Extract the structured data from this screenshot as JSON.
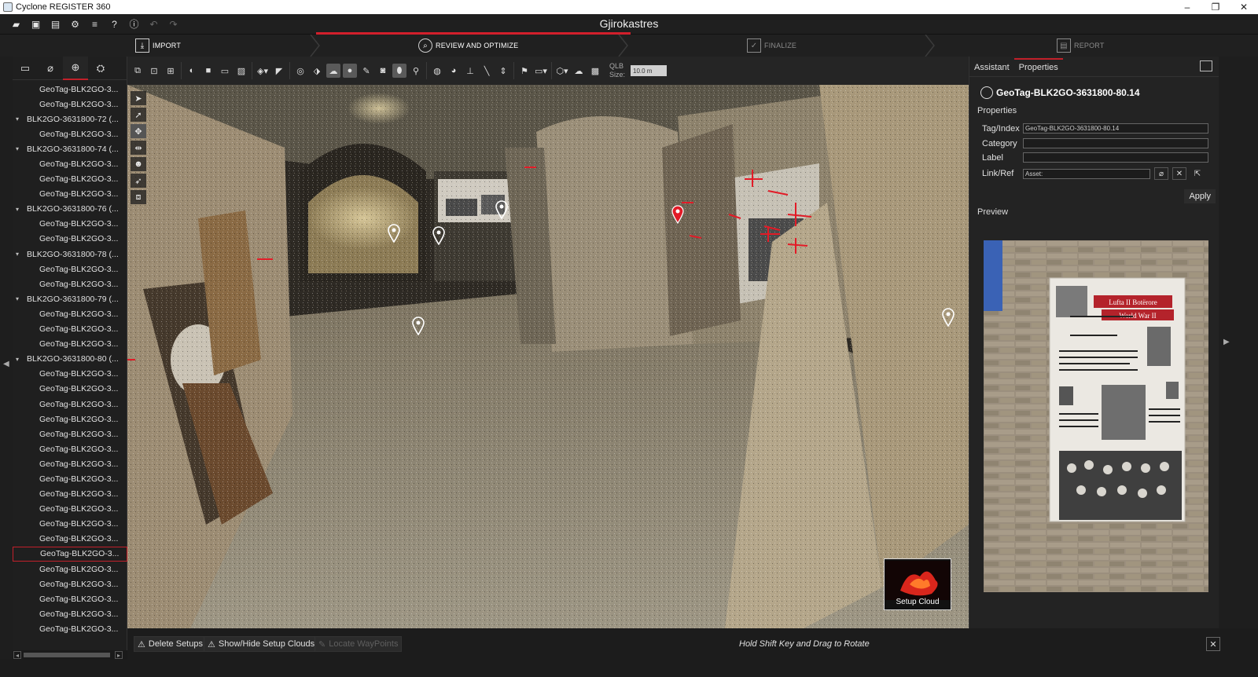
{
  "window": {
    "title": "Cyclone REGISTER 360",
    "controls": [
      "–",
      "❐",
      "✕"
    ]
  },
  "project": {
    "title": "Gjirokastres"
  },
  "workflow": {
    "steps": [
      {
        "label": "IMPORT",
        "icon": "import-icon",
        "state": "done"
      },
      {
        "label": "REVIEW AND OPTIMIZE",
        "icon": "review-icon",
        "state": "active"
      },
      {
        "label": "FINALIZE",
        "icon": "finalize-icon",
        "state": "inactive"
      },
      {
        "label": "REPORT",
        "icon": "report-icon",
        "state": "inactive"
      }
    ],
    "accent": "#d21f2b"
  },
  "left_panel": {
    "tabs": [
      "setups-icon",
      "links-icon",
      "geotag-icon",
      "settings-icon"
    ],
    "tree": [
      {
        "type": "child",
        "label": "GeoTag-BLK2GO-3..."
      },
      {
        "type": "child",
        "label": "GeoTag-BLK2GO-3..."
      },
      {
        "type": "group",
        "label": "BLK2GO-3631800-72 (..."
      },
      {
        "type": "child",
        "label": "GeoTag-BLK2GO-3..."
      },
      {
        "type": "group",
        "label": "BLK2GO-3631800-74 (..."
      },
      {
        "type": "child",
        "label": "GeoTag-BLK2GO-3..."
      },
      {
        "type": "child",
        "label": "GeoTag-BLK2GO-3..."
      },
      {
        "type": "child",
        "label": "GeoTag-BLK2GO-3..."
      },
      {
        "type": "group",
        "label": "BLK2GO-3631800-76 (..."
      },
      {
        "type": "child",
        "label": "GeoTag-BLK2GO-3..."
      },
      {
        "type": "child",
        "label": "GeoTag-BLK2GO-3..."
      },
      {
        "type": "group",
        "label": "BLK2GO-3631800-78 (..."
      },
      {
        "type": "child",
        "label": "GeoTag-BLK2GO-3..."
      },
      {
        "type": "child",
        "label": "GeoTag-BLK2GO-3..."
      },
      {
        "type": "group",
        "label": "BLK2GO-3631800-79 (..."
      },
      {
        "type": "child",
        "label": "GeoTag-BLK2GO-3..."
      },
      {
        "type": "child",
        "label": "GeoTag-BLK2GO-3..."
      },
      {
        "type": "child",
        "label": "GeoTag-BLK2GO-3..."
      },
      {
        "type": "group",
        "label": "BLK2GO-3631800-80 (..."
      },
      {
        "type": "child",
        "label": "GeoTag-BLK2GO-3..."
      },
      {
        "type": "child",
        "label": "GeoTag-BLK2GO-3..."
      },
      {
        "type": "child",
        "label": "GeoTag-BLK2GO-3..."
      },
      {
        "type": "child",
        "label": "GeoTag-BLK2GO-3..."
      },
      {
        "type": "child",
        "label": "GeoTag-BLK2GO-3..."
      },
      {
        "type": "child",
        "label": "GeoTag-BLK2GO-3..."
      },
      {
        "type": "child",
        "label": "GeoTag-BLK2GO-3..."
      },
      {
        "type": "child",
        "label": "GeoTag-BLK2GO-3..."
      },
      {
        "type": "child",
        "label": "GeoTag-BLK2GO-3..."
      },
      {
        "type": "child",
        "label": "GeoTag-BLK2GO-3..."
      },
      {
        "type": "child",
        "label": "GeoTag-BLK2GO-3..."
      },
      {
        "type": "child",
        "label": "GeoTag-BLK2GO-3..."
      },
      {
        "type": "child",
        "label": "GeoTag-BLK2GO-3...",
        "selected": true
      },
      {
        "type": "child",
        "label": "GeoTag-BLK2GO-3..."
      },
      {
        "type": "child",
        "label": "GeoTag-BLK2GO-3..."
      },
      {
        "type": "child",
        "label": "GeoTag-BLK2GO-3..."
      },
      {
        "type": "child",
        "label": "GeoTag-BLK2GO-3..."
      },
      {
        "type": "child",
        "label": "GeoTag-BLK2GO-3..."
      }
    ]
  },
  "viewport_toolbar": {
    "qlb_label_1": "QLB",
    "qlb_label_2": "Size:",
    "qlb_value": "10.0 m"
  },
  "viewport": {
    "setup_cloud_label": "Setup Cloud"
  },
  "right_panel": {
    "tabs": [
      "Assistant",
      "Properties"
    ],
    "active_tab": "Properties",
    "object_title": "GeoTag-BLK2GO-3631800-80.14",
    "section_properties": "Properties",
    "fields": {
      "tag_label": "Tag/Index",
      "tag_value": "GeoTag-BLK2GO-3631800-80.14",
      "category_label": "Category",
      "category_value": "",
      "label_label": "Label",
      "label_value": "",
      "link_label": "Link/Ref",
      "link_value": "Asset:"
    },
    "apply_label": "Apply",
    "section_preview": "Preview",
    "preview_sign_line1": "Lufta II Botërore",
    "preview_sign_line2": "World War II"
  },
  "bottom_bar": {
    "delete_setups": "Delete Setups",
    "show_hide": "Show/Hide Setup Clouds",
    "locate_waypoints": "Locate WayPoints",
    "hint": "Hold Shift Key and Drag to Rotate"
  }
}
